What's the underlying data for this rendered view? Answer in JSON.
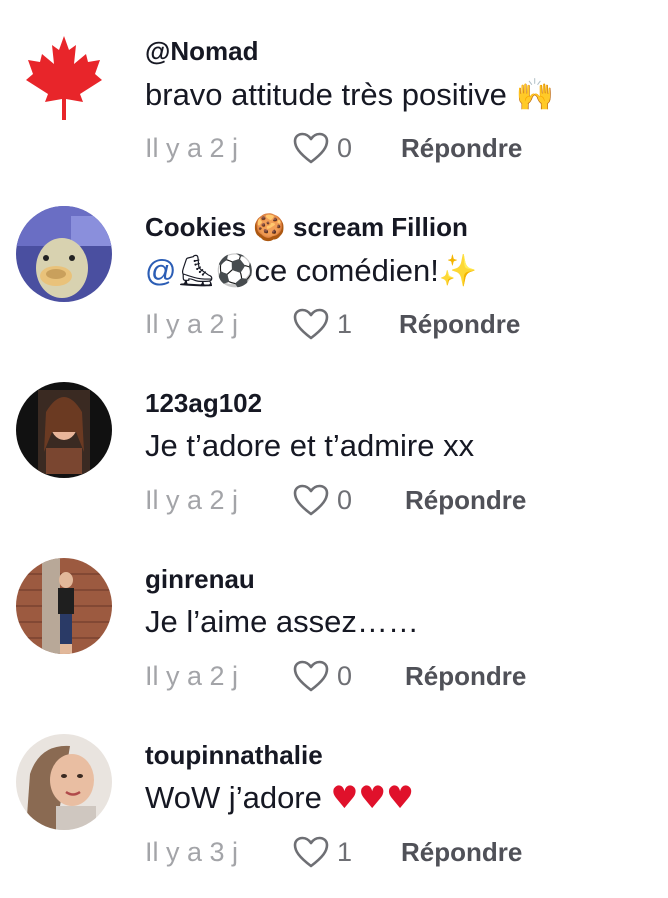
{
  "comments": [
    {
      "username": "@Nomad",
      "text": "bravo attitude très positive",
      "emoji": "🙌",
      "time": "Il y a 2 j",
      "likes": "0",
      "reply_label": "Répondre",
      "avatar_icon": "maple-leaf-icon"
    },
    {
      "username_part1": "Cookies",
      "username_emoji": "🍪",
      "username_part2": "scream Fillion",
      "mention": "@",
      "mention_emojis": "⛸⚽",
      "text": "ce comédien!",
      "sparkle": "✨",
      "time": "Il y a 2 j",
      "likes": "1",
      "reply_label": "Répondre",
      "avatar_icon": "duck-photo"
    },
    {
      "username": "123ag102",
      "text": "Je t’adore et t’admire xx",
      "time": "Il y a 2 j",
      "likes": "0",
      "reply_label": "Répondre",
      "avatar_icon": "woman-photo"
    },
    {
      "username": "ginrenau",
      "text": "Je l’aime assez……",
      "time": "Il y a 2 j",
      "likes": "0",
      "reply_label": "Répondre",
      "avatar_icon": "woman-brick-wall-photo"
    },
    {
      "username": "toupinnathalie",
      "text": "WoW j’adore",
      "hearts": "♥♥♥",
      "time": "Il y a 3 j",
      "likes": "1",
      "reply_label": "Répondre",
      "avatar_icon": "selfie-photo"
    }
  ],
  "colors": {
    "username": "#161823",
    "time": "#a3a4a8",
    "reply": "#505158",
    "mention": "#2b5db5",
    "heart_emoji": "#e0112b",
    "maple_leaf": "#e8252a"
  }
}
